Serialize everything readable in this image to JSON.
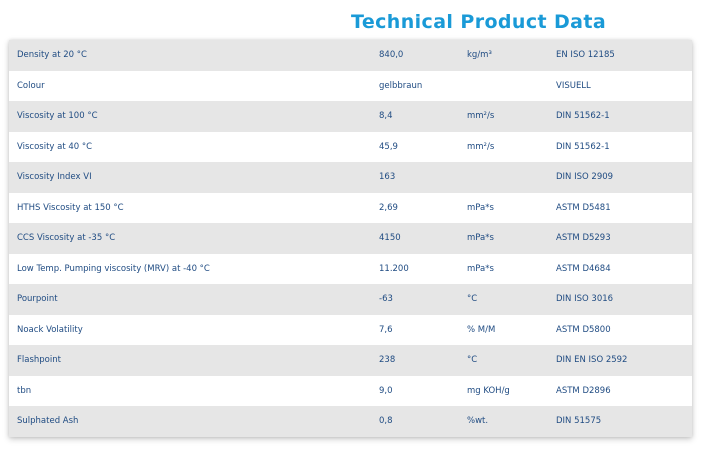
{
  "title": "Technical Product Data",
  "colors": {
    "title": "#1a9ad7",
    "text": "#1f4b82",
    "row_alt": "#e6e6e6",
    "row": "#ffffff"
  },
  "rows": [
    {
      "property": "Density at 20 °C",
      "value": "840,0",
      "unit": "kg/m³",
      "method": "EN ISO 12185"
    },
    {
      "property": "Colour",
      "value": "gelbbraun",
      "unit": "",
      "method": "VISUELL"
    },
    {
      "property": "Viscosity at 100 °C",
      "value": "8,4",
      "unit": "mm²/s",
      "method": "DIN 51562-1"
    },
    {
      "property": "Viscosity at 40 °C",
      "value": "45,9",
      "unit": "mm²/s",
      "method": "DIN 51562-1"
    },
    {
      "property": "Viscosity Index VI",
      "value": "163",
      "unit": "",
      "method": "DIN ISO 2909"
    },
    {
      "property": "HTHS Viscosity at 150 °C",
      "value": "2,69",
      "unit": "mPa*s",
      "method": "ASTM D5481"
    },
    {
      "property": "CCS Viscosity at -35 °C",
      "value": "4150",
      "unit": "mPa*s",
      "method": "ASTM D5293"
    },
    {
      "property": "Low Temp. Pumping viscosity (MRV) at -40 °C",
      "value": "11.200",
      "unit": "mPa*s",
      "method": "ASTM D4684"
    },
    {
      "property": "Pourpoint",
      "value": "-63",
      "unit": "°C",
      "method": "DIN ISO 3016"
    },
    {
      "property": "Noack Volatility",
      "value": "7,6",
      "unit": "% M/M",
      "method": "ASTM D5800"
    },
    {
      "property": "Flashpoint",
      "value": "238",
      "unit": "°C",
      "method": "DIN EN ISO 2592"
    },
    {
      "property": "tbn",
      "value": "9,0",
      "unit": "mg KOH/g",
      "method": "ASTM D2896"
    },
    {
      "property": "Sulphated Ash",
      "value": "0,8",
      "unit": "%wt.",
      "method": "DIN 51575"
    }
  ]
}
